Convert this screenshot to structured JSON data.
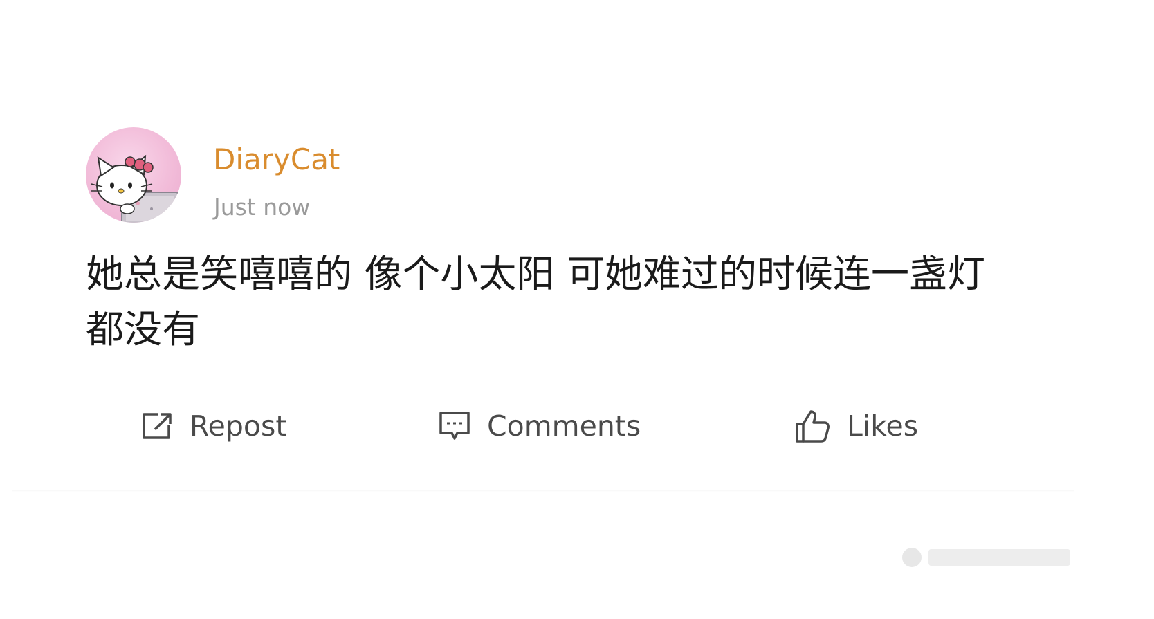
{
  "post": {
    "username": "DiaryCat",
    "timestamp": "Just now",
    "text": "她总是笑嘻嘻的 像个小太阳 可她难过的时候连一盏灯都没有",
    "avatar_icon": "hello-kitty-avatar-icon"
  },
  "actions": {
    "repost_label": "Repost",
    "comments_label": "Comments",
    "likes_label": "Likes"
  },
  "colors": {
    "username": "#d98c2e",
    "timestamp": "#9a9a9a",
    "text": "#1a1a1a",
    "action": "#4a4a4a",
    "avatar_bg": "#f2bcd9"
  }
}
